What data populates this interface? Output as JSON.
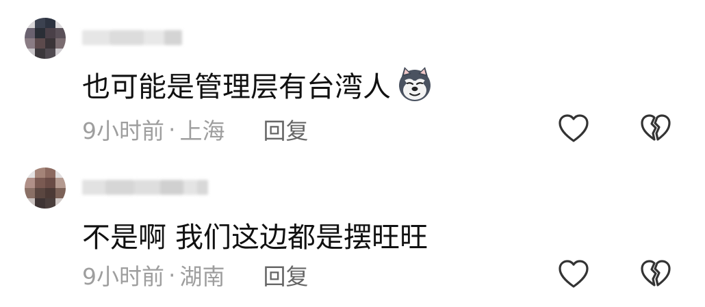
{
  "comments": [
    {
      "text": "也可能是管理层有台湾人",
      "emoji": "doge-icon",
      "time": "9小时前",
      "separator": "·",
      "location": "上海",
      "reply_label": "回复"
    },
    {
      "text": "不是啊 我们这边都是摆旺旺",
      "time": "9小时前",
      "separator": "·",
      "location": "湖南",
      "reply_label": "回复"
    }
  ],
  "icons": {
    "like": "heart-outline-icon",
    "dislike": "broken-heart-icon"
  },
  "colors": {
    "text": "#111111",
    "meta": "#9e9e9e",
    "reply": "#666666",
    "icon_stroke": "#333333"
  }
}
